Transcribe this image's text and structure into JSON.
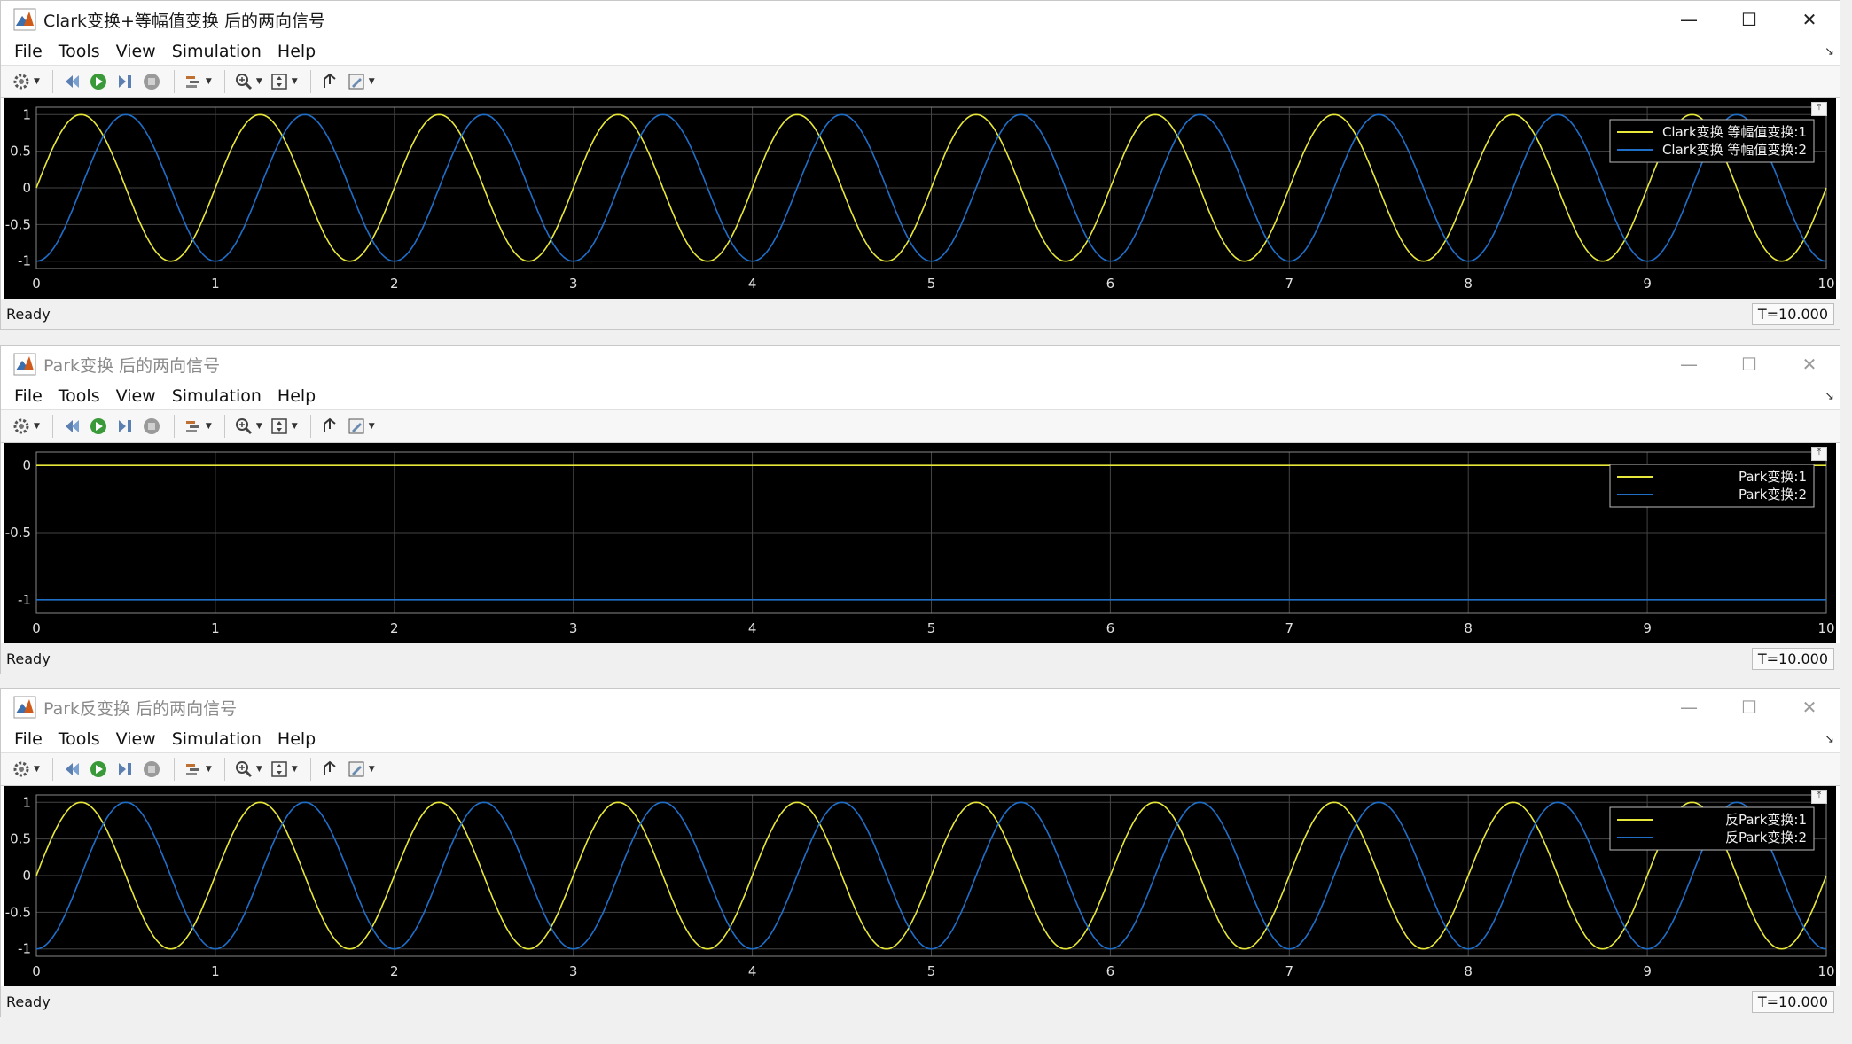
{
  "menus": [
    "File",
    "Tools",
    "View",
    "Simulation",
    "Help"
  ],
  "windows": [
    {
      "title": "Clark变换+等幅值变换 后的两向信号",
      "status": "Ready",
      "time": "T=10.000",
      "active": true,
      "yticks": [
        "1",
        "0.5",
        "0",
        "-0.5",
        "-1"
      ],
      "xticks": [
        "0",
        "1",
        "2",
        "3",
        "4",
        "5",
        "6",
        "7",
        "8",
        "9",
        "10"
      ],
      "legend": [
        "Clark变换 等幅值变换:1",
        "Clark变换 等幅值变换:2"
      ]
    },
    {
      "title": "Park变换 后的两向信号",
      "status": "Ready",
      "time": "T=10.000",
      "active": false,
      "yticks": [
        "0",
        "-0.5",
        "-1"
      ],
      "xticks": [
        "0",
        "1",
        "2",
        "3",
        "4",
        "5",
        "6",
        "7",
        "8",
        "9",
        "10"
      ],
      "legend": [
        "Park变换:1",
        "Park变换:2"
      ]
    },
    {
      "title": "Park反变换 后的两向信号",
      "status": "Ready",
      "time": "T=10.000",
      "active": false,
      "yticks": [
        "1",
        "0.5",
        "0",
        "-0.5",
        "-1"
      ],
      "xticks": [
        "0",
        "1",
        "2",
        "3",
        "4",
        "5",
        "6",
        "7",
        "8",
        "9",
        "10"
      ],
      "legend": [
        "反Park变换:1",
        "反Park变换:2"
      ]
    }
  ],
  "chart_data": [
    {
      "type": "line",
      "xlim": [
        0,
        10
      ],
      "ylim": [
        -1.1,
        1.1
      ],
      "grid": true,
      "legend_position": "top-right",
      "series": [
        {
          "name": "Clark变换 等幅值变换:1",
          "color": "#e8e83a",
          "function": "sin",
          "frequency": 1,
          "amplitude": 1,
          "phase_deg": 0
        },
        {
          "name": "Clark变换 等幅值变换:2",
          "color": "#1f6fc9",
          "function": "sin",
          "frequency": 1,
          "amplitude": 1,
          "phase_deg": -90
        }
      ]
    },
    {
      "type": "line",
      "xlim": [
        0,
        10
      ],
      "ylim": [
        -1.1,
        0.1
      ],
      "grid": true,
      "legend_position": "top-right",
      "series": [
        {
          "name": "Park变换:1",
          "color": "#e8e83a",
          "function": "const",
          "value": 0
        },
        {
          "name": "Park变换:2",
          "color": "#1f6fc9",
          "function": "const",
          "value": -1
        }
      ]
    },
    {
      "type": "line",
      "xlim": [
        0,
        10
      ],
      "ylim": [
        -1.1,
        1.1
      ],
      "grid": true,
      "legend_position": "top-right",
      "series": [
        {
          "name": "反Park变换:1",
          "color": "#e8e83a",
          "function": "sin",
          "frequency": 1,
          "amplitude": 1,
          "phase_deg": 0
        },
        {
          "name": "反Park变换:2",
          "color": "#1f6fc9",
          "function": "sin",
          "frequency": 1,
          "amplitude": 1,
          "phase_deg": -90
        }
      ]
    }
  ],
  "icons": [
    "settings-icon",
    "rewind-icon",
    "run-icon",
    "step-icon",
    "stop-icon",
    "highlight-icon",
    "zoom-icon",
    "fit-icon",
    "restore-icon",
    "edit-icon"
  ]
}
